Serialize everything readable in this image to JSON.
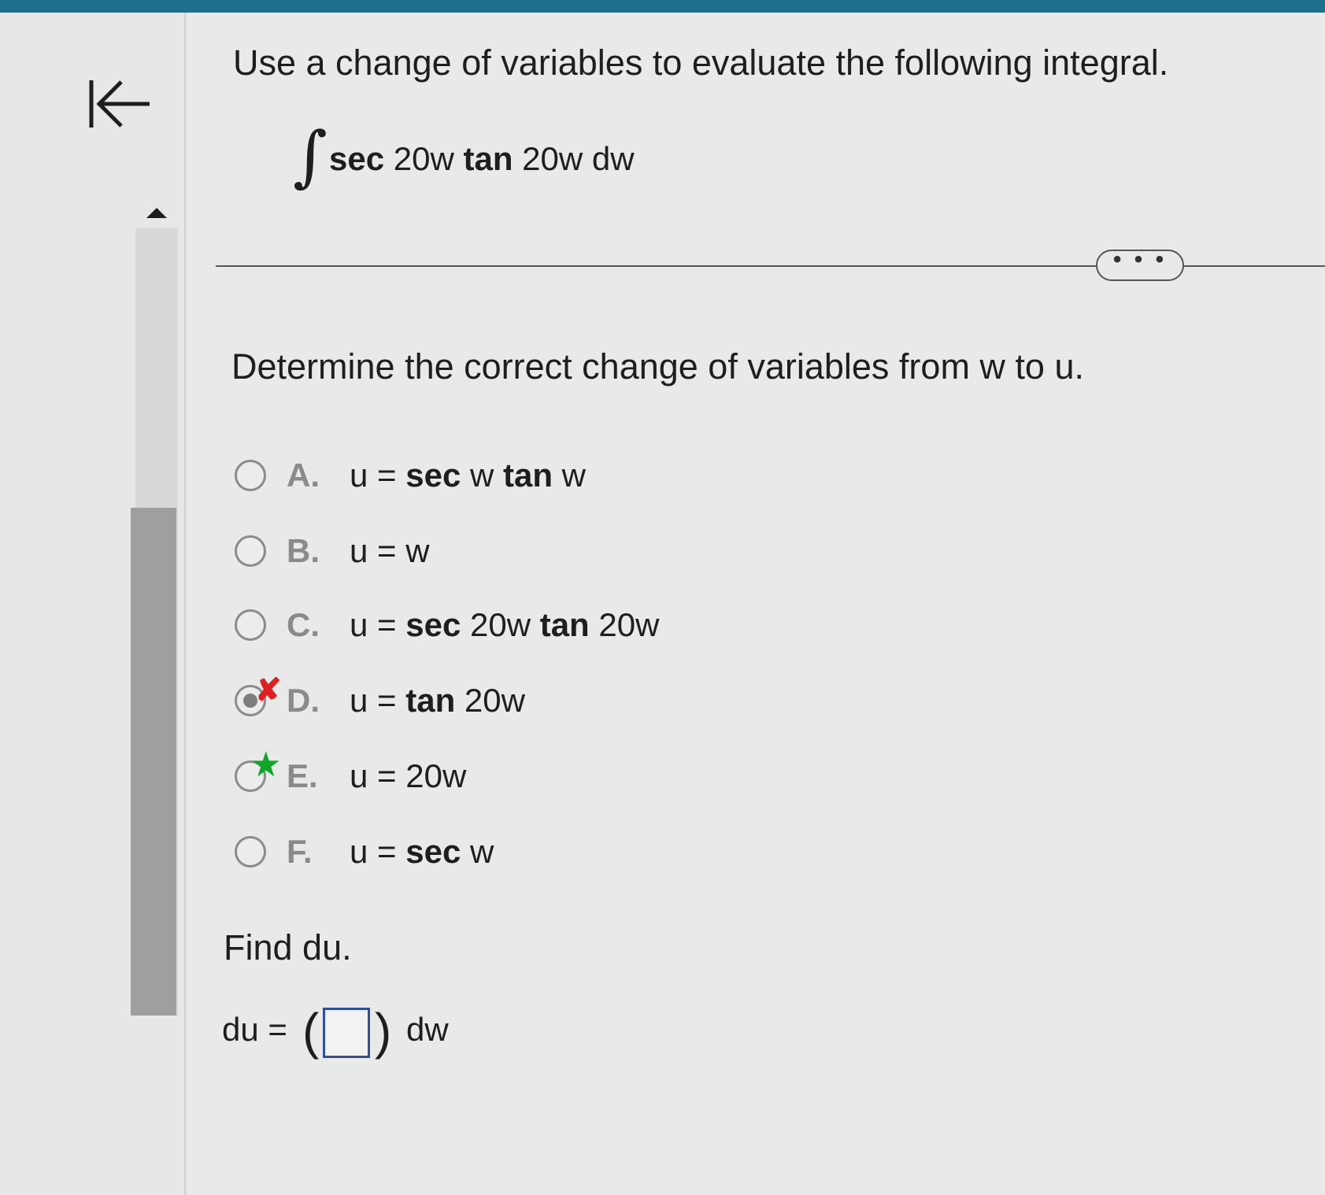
{
  "question": {
    "text": "Use a change of variables to evaluate the following integral.",
    "integral_sign": "∫",
    "integrand": {
      "sec": "sec",
      "arg1": "20w",
      "tan": "tan",
      "arg2": "20w dw"
    }
  },
  "more_button": "• • •",
  "prompt": "Determine the correct change of variables from w to u.",
  "options": [
    {
      "letter": "A.",
      "lhs": "u =",
      "parts": [
        {
          "t": "sec",
          "b": true
        },
        {
          "t": " w ",
          "b": false
        },
        {
          "t": "tan",
          "b": true
        },
        {
          "t": " w",
          "b": false
        }
      ],
      "selected": false,
      "mark": ""
    },
    {
      "letter": "B.",
      "lhs": "u =",
      "parts": [
        {
          "t": "w",
          "b": false
        }
      ],
      "selected": false,
      "mark": ""
    },
    {
      "letter": "C.",
      "lhs": "u =",
      "parts": [
        {
          "t": "sec",
          "b": true
        },
        {
          "t": " 20w ",
          "b": false
        },
        {
          "t": "tan",
          "b": true
        },
        {
          "t": " 20w",
          "b": false
        }
      ],
      "selected": false,
      "mark": ""
    },
    {
      "letter": "D.",
      "lhs": "u =",
      "parts": [
        {
          "t": "tan",
          "b": true
        },
        {
          "t": " 20w",
          "b": false
        }
      ],
      "selected": true,
      "mark": "incorrect"
    },
    {
      "letter": "E.",
      "lhs": "u =",
      "parts": [
        {
          "t": "20w",
          "b": false
        }
      ],
      "selected": false,
      "mark": "correct"
    },
    {
      "letter": "F.",
      "lhs": "u =",
      "parts": [
        {
          "t": "sec",
          "b": true
        },
        {
          "t": " w",
          "b": false
        }
      ],
      "selected": false,
      "mark": ""
    }
  ],
  "option_exprs": {
    "a": {
      "p1": "sec",
      "p2": " w ",
      "p3": "tan",
      "p4": " w"
    },
    "b": {
      "p1": "w"
    },
    "c": {
      "p1": "sec",
      "p2": " 20w ",
      "p3": "tan",
      "p4": " 20w"
    },
    "d": {
      "p1": "tan",
      "p2": " 20w"
    },
    "e": {
      "p1": "20w"
    },
    "f": {
      "p1": "sec",
      "p2": " w"
    }
  },
  "marks": {
    "incorrect_symbol": "✘",
    "correct_symbol": "★",
    "incorrect_color": "#e02020",
    "correct_color": "#11a52a"
  },
  "find": {
    "text": "Find du.",
    "du_label": "du =",
    "open_paren": "(",
    "close_paren": ")",
    "dw": "dw",
    "answer_value": ""
  },
  "colors": {
    "top_bar": "#1e6f8e",
    "scroll_thumb": "#9f9f9f",
    "answer_box_border": "#2f4f9a"
  }
}
